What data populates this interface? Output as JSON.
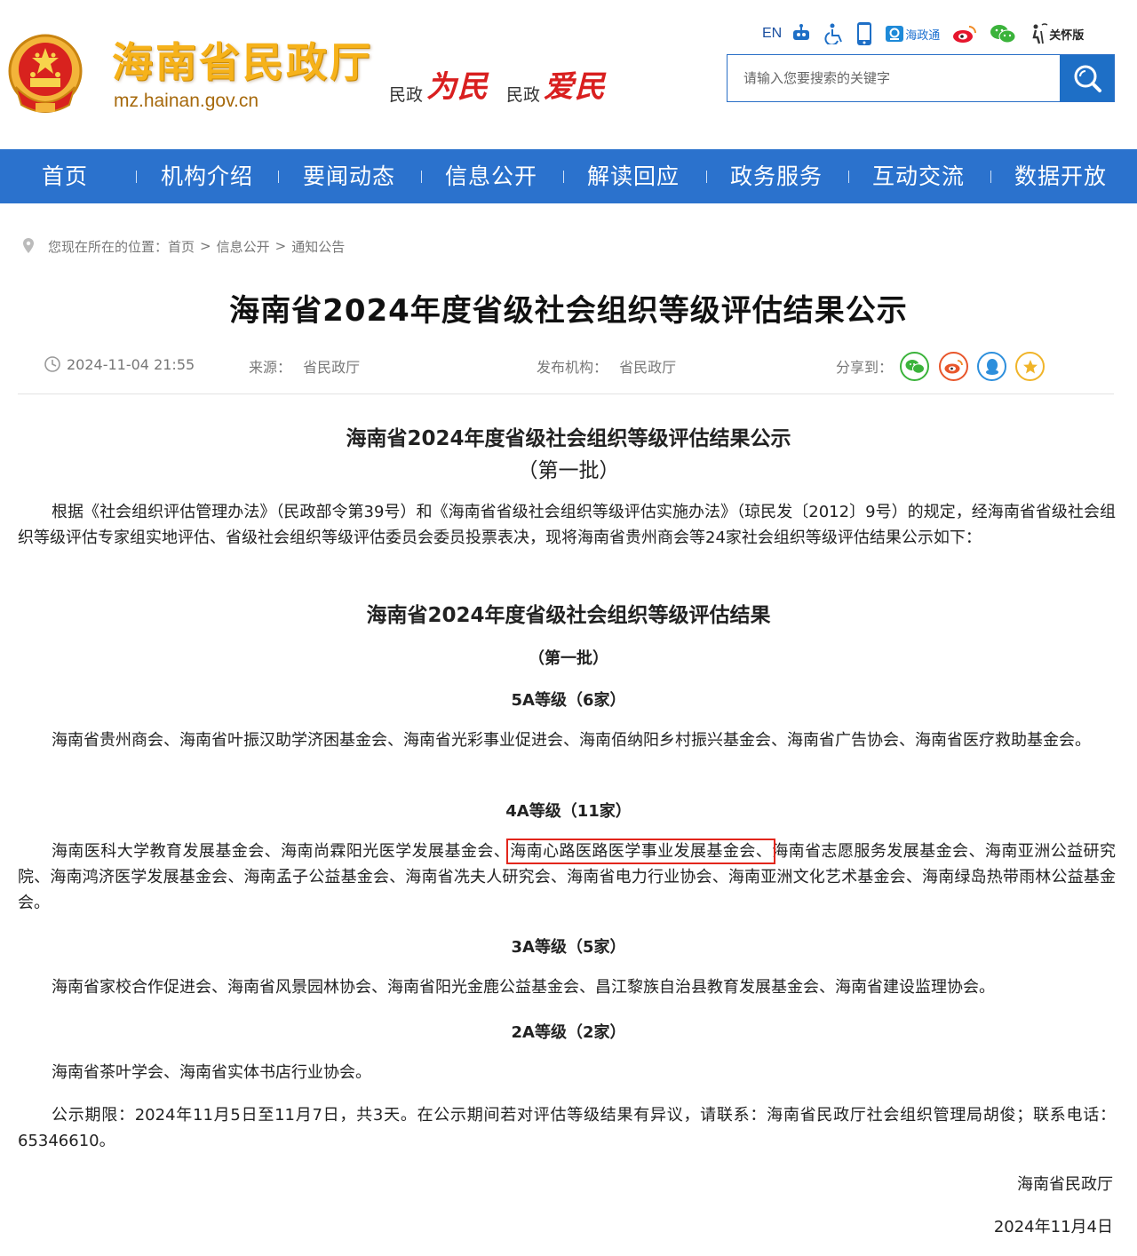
{
  "header": {
    "site_name": "海南省民政厅",
    "domain": "mz.hainan.gov.cn",
    "slogans": [
      {
        "small": "民政",
        "big": "为民"
      },
      {
        "small": "民政",
        "big": "爱民"
      }
    ],
    "toolbar": {
      "en": "EN",
      "items": [
        {
          "icon": "robot-icon",
          "label": ""
        },
        {
          "icon": "accessibility-icon",
          "label": ""
        },
        {
          "icon": "mobile-phone-icon",
          "label": ""
        },
        {
          "icon": "hainan-zhengwu-app-icon",
          "label": "海政通"
        },
        {
          "icon": "weibo-icon",
          "label": ""
        },
        {
          "icon": "wechat-icon",
          "label": ""
        },
        {
          "icon": "elder-care-icon",
          "label": "关怀版"
        }
      ]
    },
    "search": {
      "placeholder": "请输入您要搜索的关键字"
    }
  },
  "nav": {
    "items": [
      "首页",
      "机构介绍",
      "要闻动态",
      "信息公开",
      "解读回应",
      "政务服务",
      "互动交流",
      "数据开放"
    ]
  },
  "breadcrumb": {
    "prefix": "您现在所在的位置：",
    "items": [
      "首页",
      "信息公开",
      "通知公告"
    ],
    "separator": ">"
  },
  "article": {
    "title": "海南省2024年度省级社会组织等级评估结果公示",
    "date": "2024-11-04 21:55",
    "source_label": "来源：",
    "source": "省民政厅",
    "publisher_label": "发布机构：",
    "publisher": "省民政厅",
    "share_label": "分享到：",
    "share_buttons": [
      "wechat-share-icon",
      "weibo-share-icon",
      "qq-share-icon",
      "favorite-star-icon"
    ],
    "share_colors": [
      "#3bb33b",
      "#e8562b",
      "#2d8fdc",
      "#f0b429"
    ],
    "body_title": "海南省2024年度省级社会组织等级评估结果公示",
    "body_subtitle": "（第一批）",
    "intro": "根据《社会组织评估管理办法》（民政部令第39号）和《海南省省级社会组织等级评估实施办法》（琼民发〔2012〕9号）的规定，经海南省省级社会组织等级评估专家组实地评估、省级社会组织等级评估委员会委员投票表决，现将海南省贵州商会等24家社会组织等级评估结果公示如下：",
    "results_title": "海南省2024年度省级社会组织等级评估结果",
    "results_subtitle": "（第一批）",
    "sections": [
      {
        "heading": "5A等级（6家）",
        "text": "海南省贵州商会、海南省叶振汉助学济困基金会、海南省光彩事业促进会、海南佰纳阳乡村振兴基金会、海南省广告协会、海南省医疗救助基金会。"
      },
      {
        "heading": "4A等级（11家）",
        "text_before": "海南医科大学教育发展基金会、海南尚霖阳光医学发展基金会、",
        "highlight": "海南心路医路医学事业发展基金会、",
        "text_after": "海南省志愿服务发展基金会、海南亚洲公益研究院、海南鸿济医学发展基金会、海南孟子公益基金会、海南省冼夫人研究会、海南省电力行业协会、海南亚洲文化艺术基金会、海南绿岛热带雨林公益基金会。"
      },
      {
        "heading": "3A等级（5家）",
        "text": "海南省家校合作促进会、海南省风景园林协会、海南省阳光金鹿公益基金会、昌江黎族自治县教育发展基金会、海南省建设监理协会。"
      },
      {
        "heading": "2A等级（2家）",
        "text": "海南省茶叶学会、海南省实体书店行业协会。"
      }
    ],
    "notice": "公示期限：2024年11月5日至11月7日，共3天。在公示期间若对评估等级结果有异议，请联系：海南省民政厅社会组织管理局胡俊；联系电话：65346610。",
    "signature_org": "海南省民政厅",
    "signature_date": "2024年11月4日"
  },
  "colors": {
    "nav_bg": "#2b72cd",
    "title_gold": "#f6b21a",
    "slogan_red": "#d91f1f",
    "highlight_border": "#e2261c"
  }
}
